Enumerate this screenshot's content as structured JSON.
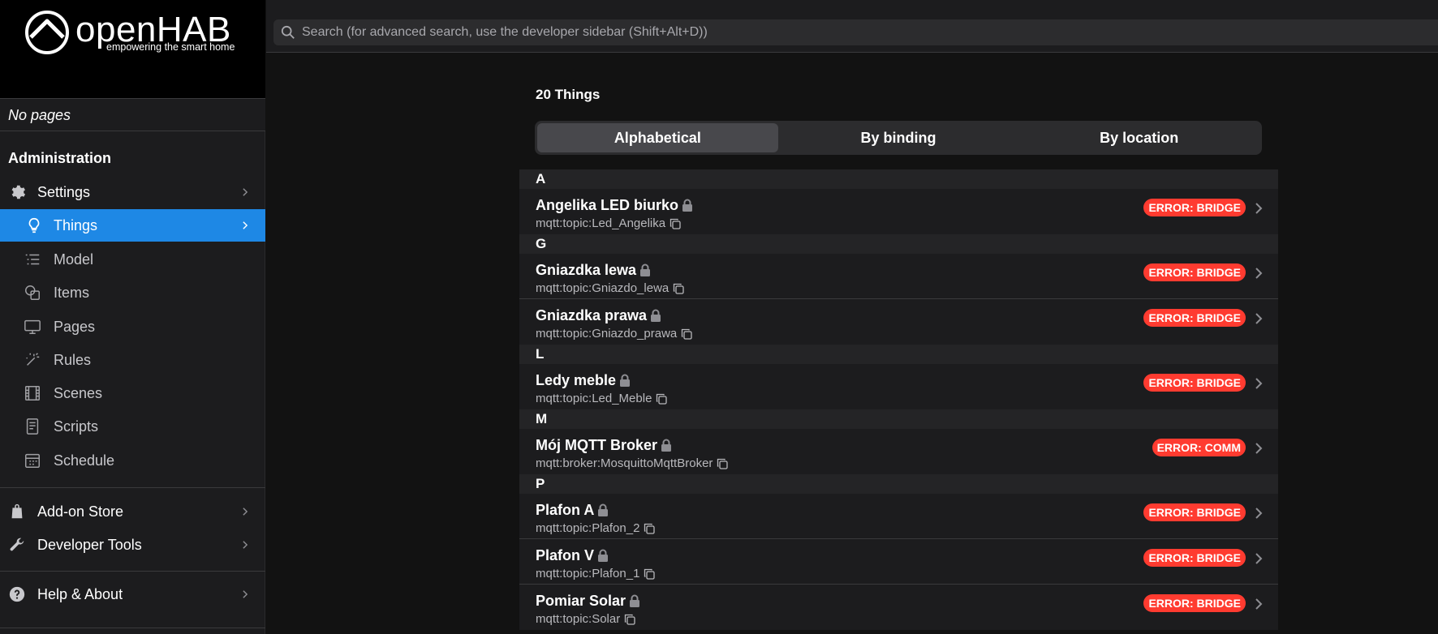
{
  "brand": {
    "name": "openHAB",
    "tagline": "empowering the smart home"
  },
  "sidebar": {
    "no_pages": "No pages",
    "admin_title": "Administration",
    "settings": "Settings",
    "things": "Things",
    "model": "Model",
    "items": "Items",
    "pages": "Pages",
    "rules": "Rules",
    "scenes": "Scenes",
    "scripts": "Scripts",
    "schedule": "Schedule",
    "addon_store": "Add-on Store",
    "developer_tools": "Developer Tools",
    "help_about": "Help & About"
  },
  "search": {
    "placeholder": "Search (for advanced search, use the developer sidebar (Shift+Alt+D))"
  },
  "content": {
    "count_label": "20 Things",
    "tabs": [
      "Alphabetical",
      "By binding",
      "By location"
    ],
    "groups": [
      {
        "letter": "A",
        "things": [
          {
            "name": "Angelika LED biurko",
            "uid": "mqtt:topic:Led_Angelika",
            "status": "ERROR: BRIDGE"
          }
        ]
      },
      {
        "letter": "G",
        "things": [
          {
            "name": "Gniazdka lewa",
            "uid": "mqtt:topic:Gniazdo_lewa",
            "status": "ERROR: BRIDGE"
          },
          {
            "name": "Gniazdka prawa",
            "uid": "mqtt:topic:Gniazdo_prawa",
            "status": "ERROR: BRIDGE"
          }
        ]
      },
      {
        "letter": "L",
        "things": [
          {
            "name": "Ledy meble",
            "uid": "mqtt:topic:Led_Meble",
            "status": "ERROR: BRIDGE"
          }
        ]
      },
      {
        "letter": "M",
        "things": [
          {
            "name": "Mój MQTT Broker",
            "uid": "mqtt:broker:MosquittoMqttBroker",
            "status": "ERROR: COMM"
          }
        ]
      },
      {
        "letter": "P",
        "things": [
          {
            "name": "Plafon A",
            "uid": "mqtt:topic:Plafon_2",
            "status": "ERROR: BRIDGE"
          },
          {
            "name": "Plafon V",
            "uid": "mqtt:topic:Plafon_1",
            "status": "ERROR: BRIDGE"
          },
          {
            "name": "Pomiar Solar",
            "uid": "mqtt:topic:Solar",
            "status": "ERROR: BRIDGE"
          }
        ]
      }
    ]
  },
  "colors": {
    "accent": "#1e88e5",
    "error_badge": "#ff3b30",
    "background": "#121212"
  },
  "icons": {
    "logo": "openhab-logo-icon",
    "settings": "gear-icon",
    "things": "lightbulb-icon",
    "model": "list-tree-icon",
    "items": "shapes-icon",
    "pages": "monitor-icon",
    "rules": "wand-icon",
    "scenes": "film-icon",
    "scripts": "document-icon",
    "schedule": "calendar-icon",
    "addon_store": "bag-icon",
    "developer_tools": "wrench-icon",
    "help_about": "question-circle-icon",
    "search": "search-icon",
    "lock": "lock-icon",
    "copy": "copy-icon",
    "chevron": "chevron-right-icon"
  }
}
